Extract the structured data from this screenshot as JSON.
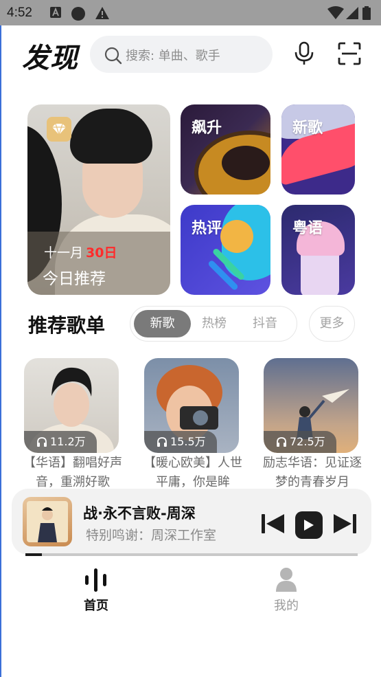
{
  "status_bar": {
    "time": "4:52"
  },
  "header": {
    "title": "发现",
    "search_placeholder": "搜索: 单曲、歌手"
  },
  "banner": {
    "main": {
      "month": "十一月",
      "day": "30日",
      "label": "今日推荐"
    },
    "tiles": [
      {
        "label": "飙升"
      },
      {
        "label": "新歌"
      },
      {
        "label": "热评"
      },
      {
        "label": "粤语"
      }
    ]
  },
  "recommend": {
    "title": "推荐歌单",
    "tabs": [
      "新歌",
      "热榜",
      "抖音"
    ],
    "active_tab": 0,
    "more": "更多",
    "playlists": [
      {
        "count": "11.2万",
        "title": "【华语】翻唱好声音，重溯好歌"
      },
      {
        "count": "15.5万",
        "title": "【暖心欧美】人世平庸，你是眸"
      },
      {
        "count": "72.5万",
        "title": "励志华语：见证逐梦的青春岁月"
      }
    ]
  },
  "player": {
    "song": "战·永不言败-周深",
    "subtitle": "特别鸣谢：周深工作室",
    "progress": 0.05
  },
  "nav": {
    "items": [
      {
        "label": "首页",
        "active": true
      },
      {
        "label": "我的",
        "active": false
      }
    ]
  },
  "colors": {
    "accent_red": "#ff2b2b",
    "status_bar": "#9e9e9e",
    "tab_active": "#7a7a7a",
    "player_bg": "#f2f2f2"
  }
}
